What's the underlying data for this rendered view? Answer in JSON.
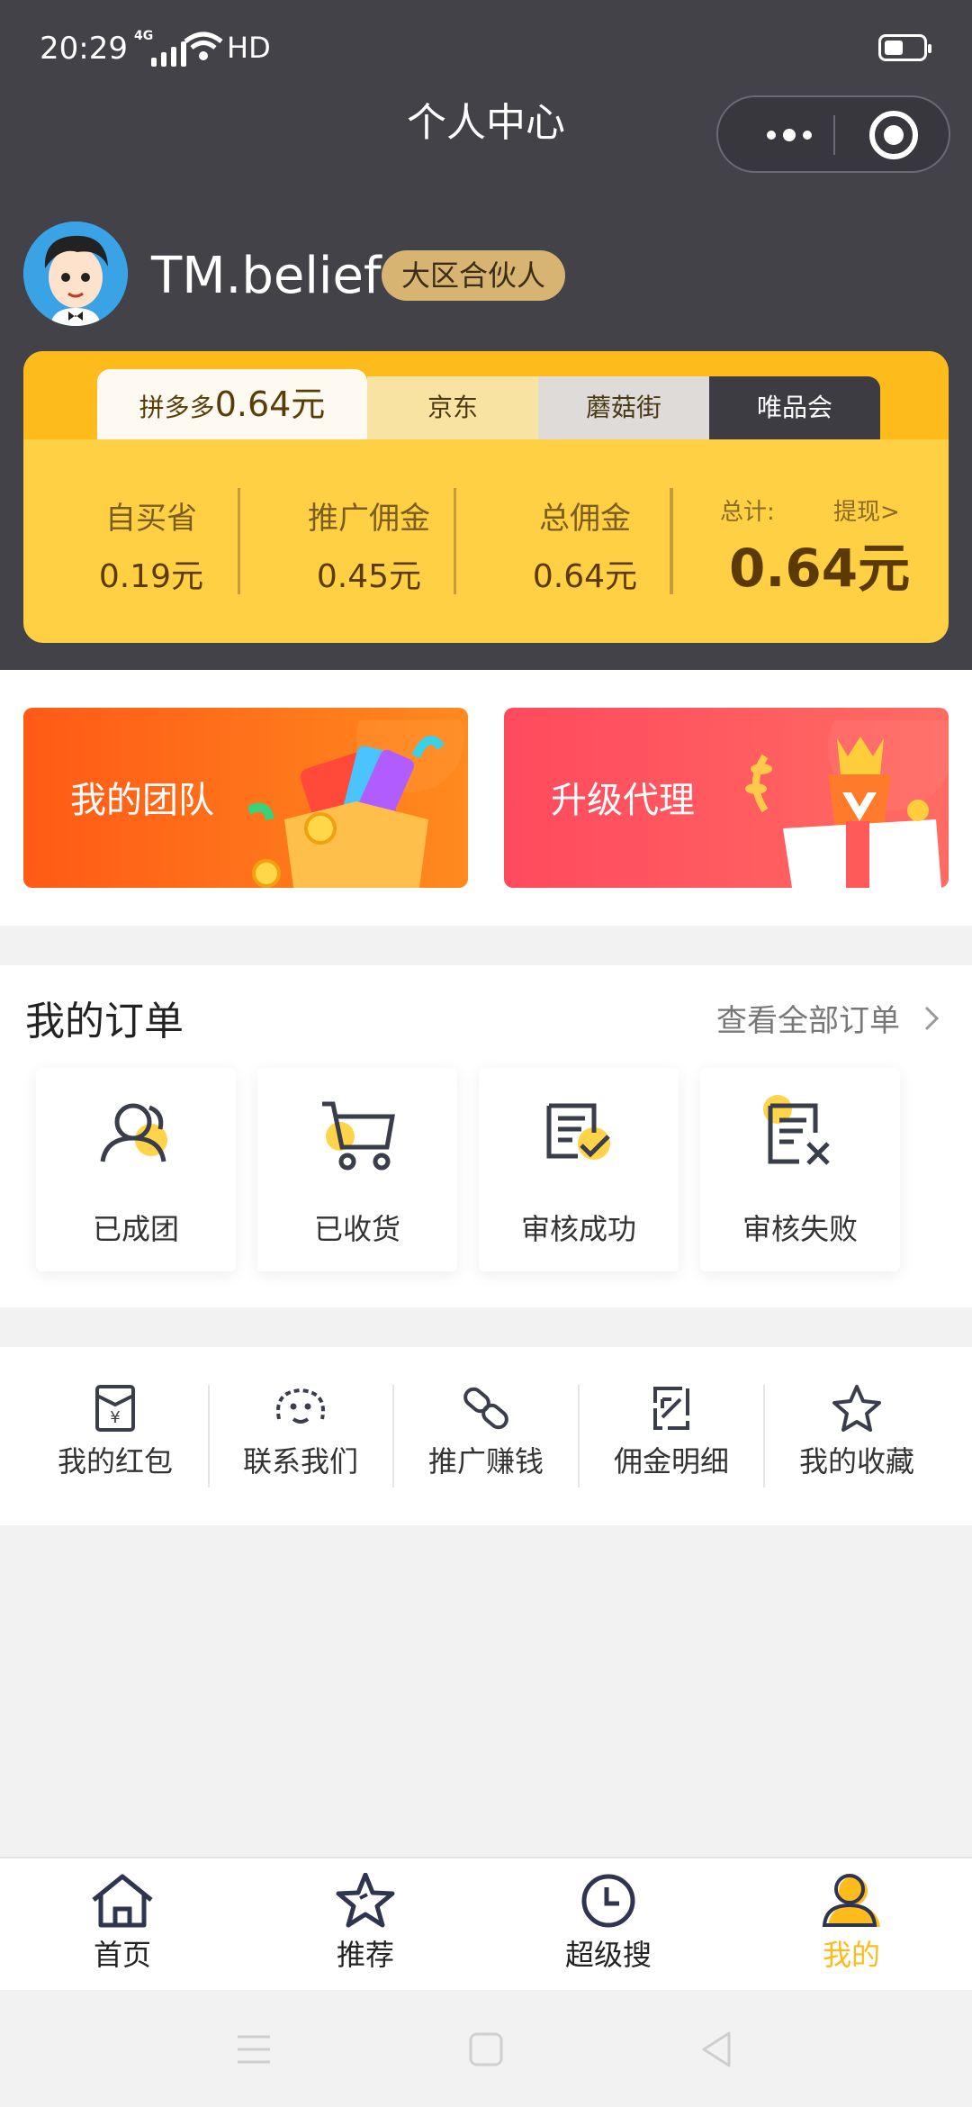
{
  "status_bar": {
    "time": "20:29",
    "network": "4G",
    "hd": "HD"
  },
  "page_title": "个人中心",
  "profile": {
    "username": "TM.belief",
    "badge": "大区合伙人"
  },
  "platform_tabs": [
    {
      "label": "拼多多",
      "amount": "0.64元"
    },
    {
      "label": "京东"
    },
    {
      "label": "蘑菇街"
    },
    {
      "label": "唯品会"
    }
  ],
  "earnings": {
    "self_saving_label": "自买省",
    "self_saving_value": "0.19元",
    "promo_commission_label": "推广佣金",
    "promo_commission_value": "0.45元",
    "total_commission_label": "总佣金",
    "total_commission_value": "0.64元",
    "total_label": "总计:",
    "withdraw_label": "提现>",
    "total_value": "0.64元"
  },
  "banners": {
    "team": "我的团队",
    "upgrade": "升级代理"
  },
  "orders": {
    "title": "我的订单",
    "view_all": "查看全部订单",
    "items": [
      "已成团",
      "已收货",
      "审核成功",
      "审核失败"
    ]
  },
  "tools": [
    "我的红包",
    "联系我们",
    "推广赚钱",
    "佣金明细",
    "我的收藏"
  ],
  "tabbar": [
    "首页",
    "推荐",
    "超级搜",
    "我的"
  ],
  "colors": {
    "accent": "#fdbb1c",
    "header_bg": "#434249",
    "card_bg": "#ffd044",
    "team_banner": "#ff6a1a",
    "upgrade_banner": "#ff4d5e"
  }
}
